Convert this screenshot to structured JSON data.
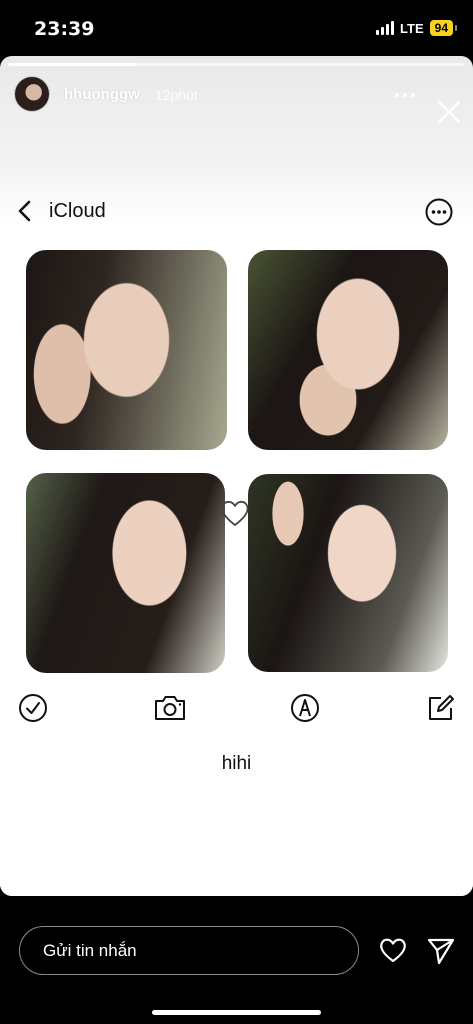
{
  "status_bar": {
    "time": "23:39",
    "network": "LTE",
    "battery": "94"
  },
  "story": {
    "progress": 0.28,
    "username": "hhuonggw",
    "posted_ago": "12phút"
  },
  "icloud": {
    "title": "iCloud",
    "caption": "hihi",
    "photos": [
      "photo-1",
      "photo-2",
      "photo-3",
      "photo-4"
    ],
    "toolbar_icons": [
      "checkmark-circle-icon",
      "camera-icon",
      "markup-pen-icon",
      "compose-icon"
    ]
  },
  "reply": {
    "placeholder": "Gửi tin nhắn"
  },
  "colors": {
    "background": "#000000",
    "card": "#ffffff",
    "battery": "#f6d321"
  }
}
